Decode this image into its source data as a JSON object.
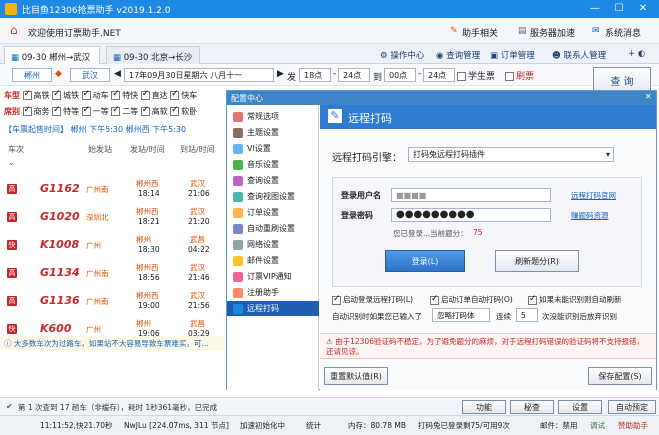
{
  "window": {
    "title": "比目鱼12306抢票助手 v2019.1.2.0",
    "controls": [
      "—",
      "☐",
      "✕"
    ]
  },
  "header": {
    "welcome": "欢迎使用订票助手.NET",
    "links": [
      {
        "label": "助手相关",
        "icon": "pen-icon"
      },
      {
        "label": "服务器加速",
        "icon": "server-icon"
      },
      {
        "label": "系统消息",
        "icon": "message-icon"
      }
    ]
  },
  "tabs": {
    "items": [
      {
        "label": "09-30 郴州→武汉",
        "active": true
      },
      {
        "label": "09-30 北京→长沙",
        "active": false
      }
    ],
    "tools": [
      {
        "label": "操作中心",
        "icon": "gear-icon"
      },
      {
        "label": "查询管理",
        "icon": "search-icon"
      },
      {
        "label": "订单管理",
        "icon": "order-icon"
      },
      {
        "label": "联系人管理",
        "icon": "contacts-icon"
      }
    ]
  },
  "query": {
    "from": "郴州",
    "to": "武汉",
    "date": "17年09月30日星期六 八月十一",
    "depart_label": "发",
    "time_from": "18点",
    "time_to": "24点",
    "arrive_label": "到",
    "arrive_from": "00点",
    "arrive_to": "24点",
    "student_label": "学生票",
    "refresh_label": "刷票",
    "search_button": "查 询"
  },
  "filters": {
    "train_types_label": "车型",
    "train_types": [
      "高铁",
      "城铁",
      "动车",
      "特快",
      "直达",
      "快车"
    ],
    "seat_label": "席别",
    "seats": [
      "商务",
      "特等",
      "一等",
      "二等",
      "高软",
      "软卧"
    ]
  },
  "train_list": {
    "notice": "【车票起售时间】 郴州 下午5:30 郴州西 下午5:30",
    "columns": [
      "车次",
      "始发站",
      "发站/时间",
      "到站/时间"
    ],
    "rows": [
      {
        "type": "高",
        "no": "G1162",
        "origin": "广州南",
        "from": "郴州西",
        "dep": "18:14",
        "to": "武汉",
        "arr": "21:06"
      },
      {
        "type": "高",
        "no": "G1020",
        "origin": "深圳北",
        "from": "郴州西",
        "dep": "18:21",
        "to": "武汉",
        "arr": "21:20"
      },
      {
        "type": "快",
        "no": "K1008",
        "origin": "广州",
        "from": "郴州",
        "dep": "18:30",
        "to": "武昌",
        "arr": "04:22"
      },
      {
        "type": "高",
        "no": "G1134",
        "origin": "广州南",
        "from": "郴州西",
        "dep": "18:56",
        "to": "武汉",
        "arr": "21:46"
      },
      {
        "type": "高",
        "no": "G1136",
        "origin": "广州南",
        "from": "郴州西",
        "dep": "19:00",
        "to": "武汉",
        "arr": "21:56"
      },
      {
        "type": "快",
        "no": "K600",
        "origin": "广州",
        "from": "郴州",
        "dep": "19:06",
        "to": "武昌",
        "arr": "03:29"
      }
    ],
    "tip": "大多数车次为过路车，如果站不大容易导致车票难买，可..."
  },
  "dialog": {
    "title": "配置中心",
    "menu": [
      {
        "label": "常规选项",
        "color": "#e57373"
      },
      {
        "label": "主题设置",
        "color": "#8d6e63"
      },
      {
        "label": "VI设置",
        "color": "#64b5f6"
      },
      {
        "label": "音乐设置",
        "color": "#4caf50"
      },
      {
        "label": "查询设置",
        "color": "#ba68c8"
      },
      {
        "label": "查询视图设置",
        "color": "#4db6ac"
      },
      {
        "label": "订单设置",
        "color": "#ffb74d"
      },
      {
        "label": "自动重刷设置",
        "color": "#7986cb"
      },
      {
        "label": "网络设置",
        "color": "#90a4ae"
      },
      {
        "label": "邮件设置",
        "color": "#fbc02d"
      },
      {
        "label": "订票VIP通知",
        "color": "#f06292"
      },
      {
        "label": "注册助手",
        "color": "#ff8a65"
      },
      {
        "label": "远程打码",
        "color": "#1e88e5",
        "selected": true
      }
    ],
    "panel": {
      "heading": "远程打码",
      "engine_label": "远程打码引擎：",
      "engine_value": "打码兔远程打码插件",
      "username_label": "登录用户名",
      "username_value": "■■■■",
      "password_label": "登录密码",
      "password_value": "●●●●●●●●●",
      "login_status": "您已登录...当前题分：",
      "score": "75",
      "link_website": "远程打码官网",
      "link_register": "赚题码资源",
      "login_button": "登录(L)",
      "refresh_button": "刷新题分(R)",
      "opt_auto_login": "启动登录远程打码(L)",
      "opt_auto_order": "启动订单自动打码(O)",
      "opt_auto_refresh": "如果未能识别则自动刷新",
      "retry_label": "自动识别时如果您已输入了",
      "retry_select": "忽略打码体",
      "retry_after": "连续",
      "retry_count": "5",
      "retry_tail": "次没能识别后放弃识别",
      "warning": "由于12306验证码不稳定，为了避免题分的麻烦，对于远程打码错误的验证码将不支持报错，还请见谅。",
      "reset_button": "重置默认值(R)",
      "save_button": "保存配置(S)"
    }
  },
  "status": {
    "query_info": "第 1 次查到 17 趟车（非缓存），耗时 1秒361毫秒，已完成",
    "buttons": [
      "功能",
      "秘查",
      "设置"
    ],
    "auto_label": "自动预定"
  },
  "bottom": {
    "time": "11:11:52,快21.70秒",
    "net": "NwJLu [224.07ms, 311 节点]",
    "accel": "加速初始化中",
    "stats": "统计",
    "mem": "内存：80.78 MB",
    "captcha": "打码兔已登录剩75/可用9次",
    "share": "邮件：禁用",
    "debug": "调试",
    "sponsor": "赞助助手"
  }
}
